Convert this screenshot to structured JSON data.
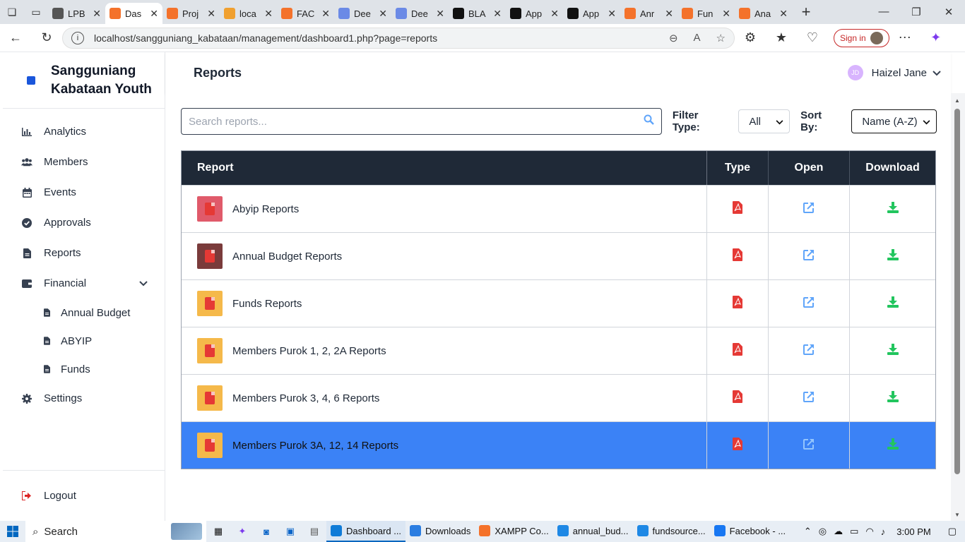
{
  "browser": {
    "tabs": [
      {
        "label": "LPB",
        "color": "#555555",
        "active": false
      },
      {
        "label": "Das",
        "color": "#f4722b",
        "active": true
      },
      {
        "label": "Proj",
        "color": "#f4722b",
        "active": false
      },
      {
        "label": "loca",
        "color": "#f0a030",
        "active": false
      },
      {
        "label": "FAC",
        "color": "#f4722b",
        "active": false
      },
      {
        "label": "Dee",
        "color": "#6b8ae6",
        "active": false
      },
      {
        "label": "Dee",
        "color": "#6b8ae6",
        "active": false
      },
      {
        "label": "BLA",
        "color": "#111111",
        "active": false
      },
      {
        "label": "App",
        "color": "#111111",
        "active": false
      },
      {
        "label": "App",
        "color": "#111111",
        "active": false
      },
      {
        "label": "Anr",
        "color": "#f4722b",
        "active": false
      },
      {
        "label": "Fun",
        "color": "#f4722b",
        "active": false
      },
      {
        "label": "Ana",
        "color": "#f4722b",
        "active": false
      }
    ],
    "url": "localhost/sangguniang_kabataan/management/dashboard1.php?page=reports",
    "signin_label": "Sign in"
  },
  "sidebar": {
    "brand": "Sangguniang Kabataan Youth",
    "items": [
      {
        "label": "Analytics",
        "icon": "chart-bar-icon"
      },
      {
        "label": "Members",
        "icon": "users-icon"
      },
      {
        "label": "Events",
        "icon": "calendar-icon"
      },
      {
        "label": "Approvals",
        "icon": "check-circle-icon"
      },
      {
        "label": "Reports",
        "icon": "file-icon"
      }
    ],
    "financial": {
      "label": "Financial",
      "icon": "wallet-icon",
      "subitems": [
        {
          "label": "Annual Budget"
        },
        {
          "label": "ABYIP"
        },
        {
          "label": "Funds"
        }
      ]
    },
    "settings_label": "Settings",
    "logout_label": "Logout"
  },
  "header": {
    "title": "Reports",
    "user_name": "Haizel Jane",
    "user_initials": "JD"
  },
  "controls": {
    "search_placeholder": "Search reports...",
    "filter_label": "Filter Type:",
    "filter_value": "All",
    "sort_label": "Sort By:",
    "sort_value": "Name (A-Z)"
  },
  "table": {
    "headers": {
      "report": "Report",
      "type": "Type",
      "open": "Open",
      "download": "Download"
    },
    "rows": [
      {
        "name": "Abyip Reports",
        "thumb_color": "#e05a6a",
        "selected": false
      },
      {
        "name": "Annual Budget Reports",
        "thumb_color": "#7a3b3b",
        "selected": false
      },
      {
        "name": "Funds Reports",
        "thumb_color": "#f5b94a",
        "selected": false
      },
      {
        "name": "Members Purok 1, 2, 2A Reports",
        "thumb_color": "#f5b94a",
        "selected": false
      },
      {
        "name": "Members Purok 3, 4, 6 Reports",
        "thumb_color": "#f5b94a",
        "selected": false
      },
      {
        "name": "Members Purok 3A, 12, 14 Reports",
        "thumb_color": "#f5b94a",
        "selected": true
      }
    ]
  },
  "colors": {
    "pdf_red": "#e53935",
    "open_blue": "#60a5fa",
    "download_green": "#22c55e",
    "selected_row": "#3b82f6",
    "table_header": "#1f2937"
  },
  "taskbar": {
    "search_label": "Search",
    "apps": [
      {
        "label": "Dashboard ...",
        "color": "#0f7bd7",
        "active": true
      },
      {
        "label": "Downloads",
        "color": "#2a7de1",
        "active": false
      },
      {
        "label": "XAMPP Co...",
        "color": "#f4722b",
        "active": false
      },
      {
        "label": "annual_bud...",
        "color": "#1e88e5",
        "active": false
      },
      {
        "label": "fundsource...",
        "color": "#1e88e5",
        "active": false
      },
      {
        "label": "Facebook - ...",
        "color": "#1877f2",
        "active": false
      }
    ],
    "time": "3:00 PM"
  }
}
